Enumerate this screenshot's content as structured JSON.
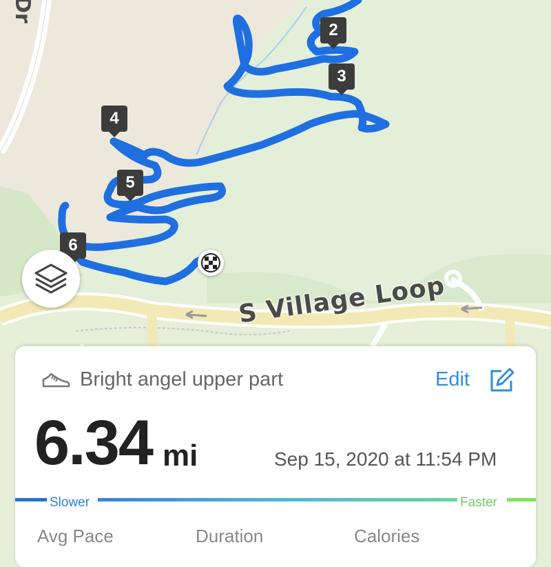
{
  "map": {
    "route_color": "#1f6fe0",
    "street_name": "S Village Loop",
    "side_road_fragment": "Dr",
    "split_markers": [
      "2",
      "3",
      "4",
      "5",
      "6"
    ]
  },
  "controls": {
    "layers_icon": "layers-icon",
    "finish_icon": "checkered-flag-icon"
  },
  "activity": {
    "icon": "shoe-icon",
    "name": "Bright angel upper part",
    "edit_label": "Edit",
    "edit_icon": "edit-icon",
    "distance": "6.34",
    "distance_unit": "mi",
    "date": "Sep 15, 2020 at 11:54 PM"
  },
  "pace_legend": {
    "slower_label": "Slower",
    "faster_label": "Faster",
    "slow_color": "#2b6fd6",
    "fast_color": "#7de35a"
  },
  "stats": {
    "labels": [
      "Avg Pace",
      "Duration",
      "Calories"
    ]
  }
}
